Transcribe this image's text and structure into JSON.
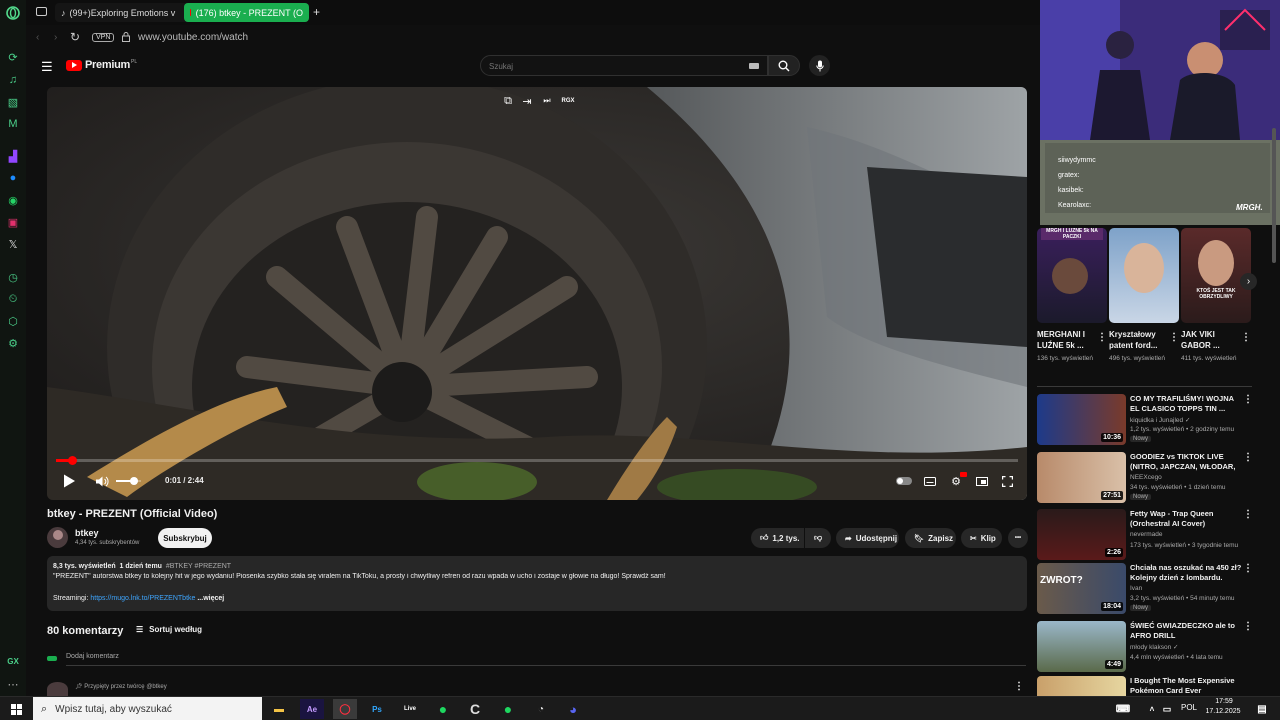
{
  "browser": {
    "tabs": [
      {
        "label": "(99+)Exploring Emotions v"
      },
      {
        "label": "(176) btkey - PREZENT (O"
      }
    ],
    "new_tab": "+",
    "url": "www.youtube.com/watch",
    "vpn": "VPN"
  },
  "yt": {
    "logo": "Premium",
    "logo_region": "PL",
    "search_placeholder": "Szukaj"
  },
  "player": {
    "time": "0:01 / 2:44",
    "progress": 0.006,
    "volume": 0.7,
    "top_label": "RGX"
  },
  "video": {
    "title": "btkey - PREZENT (Official Video)",
    "channel": "btkey",
    "subscribers": "4,34 tys. subskrybentów",
    "subscribe": "Subskrybuj",
    "likes": "1,2 tys.",
    "share": "Udostępnij",
    "save": "Zapisz",
    "clip": "Klip",
    "more": "•••"
  },
  "description": {
    "views": "8,3 tys. wyświetleń",
    "date": "1 dzień temu",
    "tags": "#BTKEY #PREZENT",
    "text": "\"PREZENT\" autorstwa btkey to kolejny hit w jego wydaniu! Piosenka szybko stała się viralem na TikToku, a prosty i chwytliwy refren od razu wpada w ucho i zostaje w głowie na długo! Sprawdź sam!",
    "streaming_label": "Streamingi: ",
    "streaming_link": "https://mugo.lnk.to/PREZENTbtke",
    "more": "...więcej"
  },
  "comments": {
    "count": "80 komentarzy",
    "sort": "Sortuj według",
    "add": "Dodaj komentarz",
    "pinned": "Przypięty przez twórcę @btkey"
  },
  "stream_chat": [
    {
      "user": "siiwydymmc"
    },
    {
      "user": "gratex:"
    },
    {
      "user": "kasibek:"
    },
    {
      "user": "Kearolaxc:"
    }
  ],
  "stream_watermark": "MRGH.",
  "shorts": [
    {
      "title": "MERGHANI I LUŹNE 5k ...",
      "views": "136 tys. wyświetleń",
      "overlay": "MRGH I LUŹNE 5k NA PACZKI"
    },
    {
      "title": "Kryształowy patent ford...",
      "views": "496 tys. wyświetleń",
      "overlay": ""
    },
    {
      "title": "JAK VIKI GABOR ...",
      "views": "411 tys. wyświetleń",
      "overlay": "KTOŚ JEST TAK OBRZYDLIWY"
    }
  ],
  "related": [
    {
      "title": "CO MY TRAFILIŚMY! WOJNA EL CLASICO TOPPS TIN ...",
      "channel": "kiquidka i Junajled",
      "meta": "1,2 tys. wyświetleń • 2 godziny temu",
      "badge": "Nowy",
      "dur": "10:36",
      "verified": true
    },
    {
      "title": "GOODIEZ vs TIKTOK LIVE (NITRO, JAPCZAN, WŁODAR, ...",
      "channel": "NEEXcego",
      "meta": "34 tys. wyświetleń • 1 dzień temu",
      "badge": "Nowy",
      "dur": "27:51",
      "verified": false
    },
    {
      "title": "Fetty Wap - Trap Queen (Orchestral AI Cover)",
      "channel": "nevermade",
      "meta": "173 tys. wyświetleń • 3 tygodnie temu",
      "badge": "",
      "dur": "2:26",
      "verified": false
    },
    {
      "title": "Chciała nas oszukać na 450 zł? Kolejny dzień z lombardu.",
      "channel": "Ivan",
      "meta": "3,2 tys. wyświetleń • 54 minuty temu",
      "badge": "Nowy",
      "dur": "18:04",
      "verified": false
    },
    {
      "title": "ŚWIEĆ GWIAZDECZKO ale to AFRO DRILL",
      "channel": "młody klakson",
      "meta": "4,4 mln wyświetleń • 4 lata temu",
      "badge": "",
      "dur": "4:49",
      "verified": true
    },
    {
      "title": "I Bought The Most Expensive Pokémon Card Ever",
      "channel": "",
      "meta": "",
      "badge": "",
      "dur": "",
      "verified": false
    }
  ],
  "taskbar": {
    "search": "Wpisz tutaj, aby wyszukać",
    "lang": "POL",
    "time": "17:59",
    "date": "17.12.2025",
    "ae": "Ae",
    "ps": "Ps",
    "live": "Live"
  },
  "sidebar_gx": "GX"
}
